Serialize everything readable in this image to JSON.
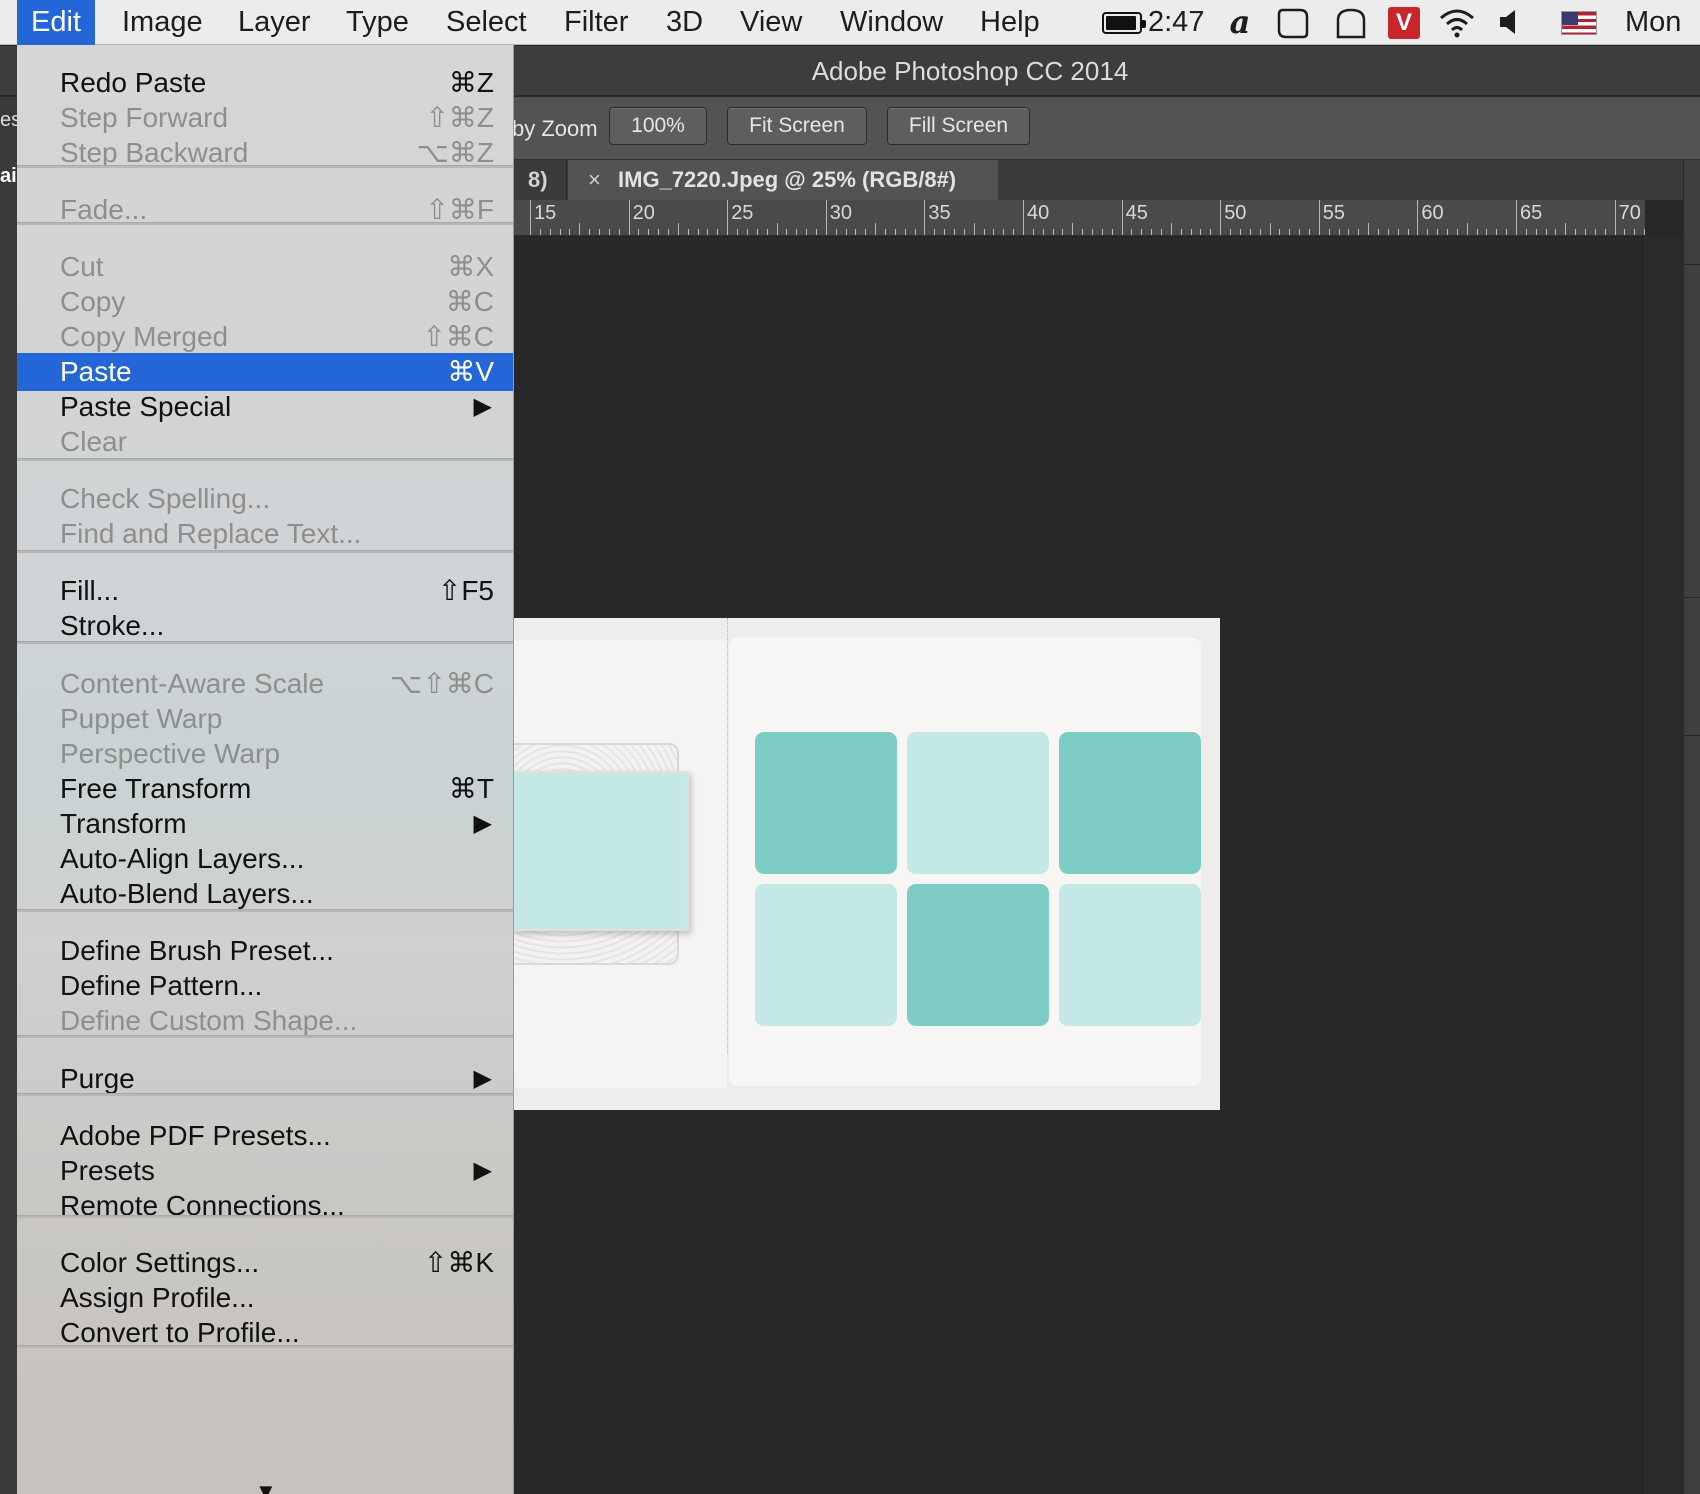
{
  "menubar": {
    "items": [
      "Edit",
      "Image",
      "Layer",
      "Type",
      "Select",
      "Filter",
      "3D",
      "View",
      "Window",
      "Help"
    ],
    "active": "Edit",
    "clock": "2:47",
    "day": "Mon F",
    "status_icons": [
      "battery-icon",
      "alfred-icon",
      "notification-icon",
      "bag-icon",
      "vivaldi-icon",
      "wifi-icon",
      "volume-icon",
      "us-flag-icon"
    ]
  },
  "window": {
    "title": "Adobe Photoshop CC 2014"
  },
  "options_bar": {
    "zoom_label": "by Zoom",
    "btn_100": "100%",
    "btn_fit": "Fit Screen",
    "btn_fill": "Fill Screen",
    "left_fragment": "es",
    "left_fragment2": "ai"
  },
  "tabs": {
    "prev_fragment": "8)",
    "close_glyph": "×",
    "active_name": "IMG_7220.Jpeg @ 25% (RGB/8#)"
  },
  "ruler": {
    "labels": [
      "15",
      "20",
      "25",
      "30",
      "35",
      "40",
      "45",
      "50",
      "55",
      "60",
      "65",
      "70"
    ]
  },
  "document": {
    "colors": {
      "dark_teal": "#7ecdc5",
      "light_teal": "#c4e8e5",
      "paper": "#efedeb"
    },
    "tiles": [
      "dark",
      "light",
      "dark",
      "light",
      "dark",
      "light"
    ]
  },
  "edit_menu": {
    "items": [
      {
        "label": "Redo Paste",
        "shortcut": "⌘Z",
        "enabled": true
      },
      {
        "label": "Step Forward",
        "shortcut": "⇧⌘Z",
        "enabled": false
      },
      {
        "label": "Step Backward",
        "shortcut": "⌥⌘Z",
        "enabled": false
      },
      {
        "label": "Fade...",
        "shortcut": "⇧⌘F",
        "enabled": false
      },
      {
        "label": "Cut",
        "shortcut": "⌘X",
        "enabled": false
      },
      {
        "label": "Copy",
        "shortcut": "⌘C",
        "enabled": false
      },
      {
        "label": "Copy Merged",
        "shortcut": "⇧⌘C",
        "enabled": false
      },
      {
        "label": "Paste",
        "shortcut": "⌘V",
        "enabled": true,
        "highlighted": true
      },
      {
        "label": "Paste Special",
        "shortcut": "",
        "enabled": true,
        "submenu": true
      },
      {
        "label": "Clear",
        "shortcut": "",
        "enabled": false
      },
      {
        "label": "Check Spelling...",
        "shortcut": "",
        "enabled": false
      },
      {
        "label": "Find and Replace Text...",
        "shortcut": "",
        "enabled": false
      },
      {
        "label": "Fill...",
        "shortcut": "⇧F5",
        "enabled": true
      },
      {
        "label": "Stroke...",
        "shortcut": "",
        "enabled": true
      },
      {
        "label": "Content-Aware Scale",
        "shortcut": "⌥⇧⌘C",
        "enabled": false
      },
      {
        "label": "Puppet Warp",
        "shortcut": "",
        "enabled": false
      },
      {
        "label": "Perspective Warp",
        "shortcut": "",
        "enabled": false
      },
      {
        "label": "Free Transform",
        "shortcut": "⌘T",
        "enabled": true
      },
      {
        "label": "Transform",
        "shortcut": "",
        "enabled": true,
        "submenu": true
      },
      {
        "label": "Auto-Align Layers...",
        "shortcut": "",
        "enabled": true
      },
      {
        "label": "Auto-Blend Layers...",
        "shortcut": "",
        "enabled": true
      },
      {
        "label": "Define Brush Preset...",
        "shortcut": "",
        "enabled": true
      },
      {
        "label": "Define Pattern...",
        "shortcut": "",
        "enabled": true
      },
      {
        "label": "Define Custom Shape...",
        "shortcut": "",
        "enabled": false
      },
      {
        "label": "Purge",
        "shortcut": "",
        "enabled": true,
        "submenu": true
      },
      {
        "label": "Adobe PDF Presets...",
        "shortcut": "",
        "enabled": true
      },
      {
        "label": "Presets",
        "shortcut": "",
        "enabled": true,
        "submenu": true
      },
      {
        "label": "Remote Connections...",
        "shortcut": "",
        "enabled": true
      },
      {
        "label": "Color Settings...",
        "shortcut": "⇧⌘K",
        "enabled": true
      },
      {
        "label": "Assign Profile...",
        "shortcut": "",
        "enabled": true
      },
      {
        "label": "Convert to Profile...",
        "shortcut": "",
        "enabled": true
      }
    ],
    "submenu_glyph": "▶",
    "scroll_glyph": "▼"
  }
}
